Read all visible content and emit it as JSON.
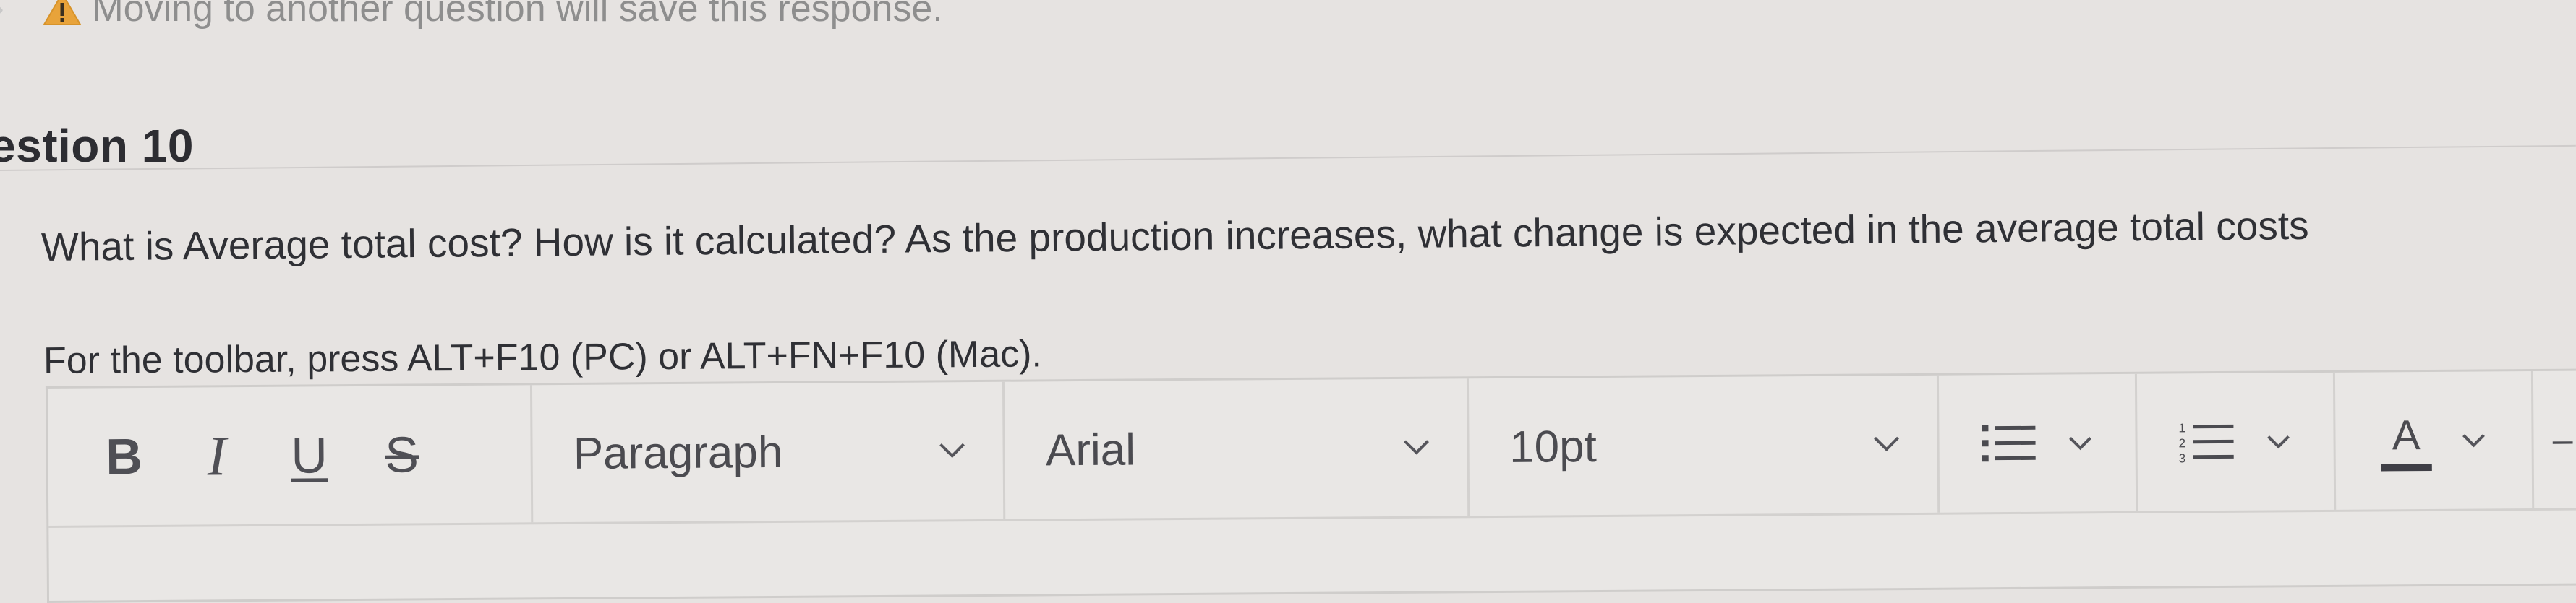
{
  "warning": {
    "icon": "warning-triangle-icon",
    "text": "Moving to another question will save this response."
  },
  "question": {
    "title": "estion 10",
    "text": "What is Average total cost? How is it calculated? As the production increases, what change is expected in the average total costs"
  },
  "editor": {
    "toolbar_hint": "For the toolbar, press ALT+F10 (PC) or ALT+FN+F10 (Mac).",
    "toolbar": {
      "bold": "B",
      "italic": "I",
      "underline": "U",
      "strikethrough": "S",
      "paragraph_select": "Paragraph",
      "font_select": "Arial",
      "size_select": "10pt",
      "text_color": "A",
      "overflow_glyph": "–"
    },
    "content": ""
  },
  "colors": {
    "background": "#e6e3e1",
    "text": "#2f3035",
    "warning": "#e8a33a",
    "border": "#d3d1cf"
  }
}
